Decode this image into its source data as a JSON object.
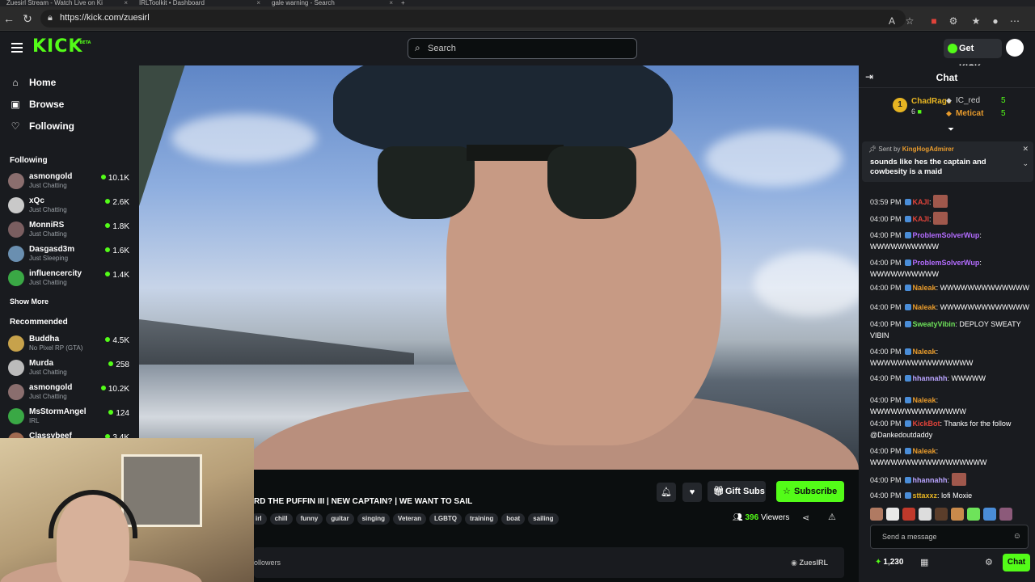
{
  "browser": {
    "tabs": [
      {
        "label": "Zuesirl Stream - Watch Live on Ki"
      },
      {
        "label": "IRLToolkit • Dashboard"
      },
      {
        "label": "gale warning - Search"
      }
    ],
    "url": "https://kick.com/zuesirl"
  },
  "header": {
    "logo": "KICK",
    "logo_badge": "BETA",
    "search_placeholder": "Search",
    "get_kicks_label": "Get KICKs"
  },
  "sidebar": {
    "nav": [
      {
        "label": "Home",
        "icon": "home-icon"
      },
      {
        "label": "Browse",
        "icon": "browse-icon"
      },
      {
        "label": "Following",
        "icon": "heart-icon"
      }
    ],
    "following_title": "Following",
    "following": [
      {
        "name": "asmongold",
        "category": "Just Chatting",
        "viewers": "10.1K"
      },
      {
        "name": "xQc",
        "category": "Just Chatting",
        "viewers": "2.6K"
      },
      {
        "name": "MonniRS",
        "category": "Just Chatting",
        "viewers": "1.8K"
      },
      {
        "name": "Dasgasd3m",
        "category": "Just Sleeping",
        "viewers": "1.6K"
      },
      {
        "name": "influencercity",
        "category": "Just Chatting",
        "viewers": "1.4K"
      }
    ],
    "show_more": "Show More",
    "recommended_title": "Recommended",
    "recommended": [
      {
        "name": "Buddha",
        "category": "No Pixel RP (GTA)",
        "viewers": "4.5K"
      },
      {
        "name": "Murda",
        "category": "Just Chatting",
        "viewers": "258"
      },
      {
        "name": "asmongold",
        "category": "Just Chatting",
        "viewers": "10.2K"
      },
      {
        "name": "MsStormAngel",
        "category": "IRL",
        "viewers": "124"
      },
      {
        "name": "Classybeef",
        "category": "",
        "viewers": "3.4K"
      }
    ]
  },
  "stream": {
    "title": "RD THE PUFFIN III | NEW CAPTAIN? | WE WANT TO SAIL",
    "tags": [
      "irl",
      "chill",
      "funny",
      "guitar",
      "singing",
      "Veteran",
      "LGBTQ",
      "training",
      "boat",
      "sailing"
    ],
    "gift_subs_label": "Gift Subs",
    "subscribe_label": "Subscribe",
    "viewers_count": "396",
    "viewers_label": "Viewers",
    "followers_label": "ollowers",
    "username": "ZuesIRL"
  },
  "chat": {
    "title": "Chat",
    "leaderboard": [
      {
        "rank": "1",
        "name": "ChadRage",
        "count": "6"
      },
      {
        "name": "IC_red",
        "count": "5"
      },
      {
        "name": "Meticat",
        "count": "5"
      }
    ],
    "pinned": {
      "sent_by_prefix": "Sent by",
      "sent_by": "KingHogAdmirer",
      "message": "sounds like hes the captain and cowbesity is a maid"
    },
    "messages": [
      {
        "time": "03:59 PM",
        "user": "KAJI",
        "text": "",
        "color": "red",
        "emote": true
      },
      {
        "time": "04:00 PM",
        "user": "KAJI",
        "text": "",
        "color": "red",
        "emote": true
      },
      {
        "time": "04:00 PM",
        "user": "ProblemSolverWup",
        "text": "WWWWWWWWWW",
        "color": "purple"
      },
      {
        "time": "04:00 PM",
        "user": "ProblemSolverWup",
        "text": "WWWWWWWWWW",
        "color": "purple"
      },
      {
        "time": "04:00 PM",
        "user": "Naleak",
        "text": "WWWWWWWWWWWWW",
        "color": "orange"
      },
      {
        "time": "04:00 PM",
        "user": "Naleak",
        "text": "WWWWWWWWWWWWW",
        "color": "orange"
      },
      {
        "time": "04:00 PM",
        "user": "SweatyVibin",
        "text": "DEPLOY SWEATY VIBIN",
        "color": "green"
      },
      {
        "time": "04:00 PM",
        "user": "Naleak",
        "text": "WWWWWWWWWWWWWWW",
        "color": "orange"
      },
      {
        "time": "04:00 PM",
        "user": "hhannahh",
        "text": "WWWWW",
        "color": "lav"
      },
      {
        "time": "04:00 PM",
        "user": "Naleak",
        "text": "WWWWWWWWWWWWWW",
        "color": "orange"
      },
      {
        "time": "04:00 PM",
        "user": "KickBot",
        "text": "Thanks for the follow @Dankedoutdaddy",
        "color": "red"
      },
      {
        "time": "04:00 PM",
        "user": "Naleak",
        "text": "WWWWWWWWWWWWWWWWW",
        "color": "orange"
      },
      {
        "time": "04:00 PM",
        "user": "hhannahh",
        "text": "",
        "color": "lav",
        "emote": true
      },
      {
        "time": "04:00 PM",
        "user": "sttaxxz",
        "text": "lofi Moxie",
        "color": "gold"
      }
    ],
    "send_placeholder": "Send a message",
    "points": "1,230",
    "chat_button": "Chat"
  }
}
